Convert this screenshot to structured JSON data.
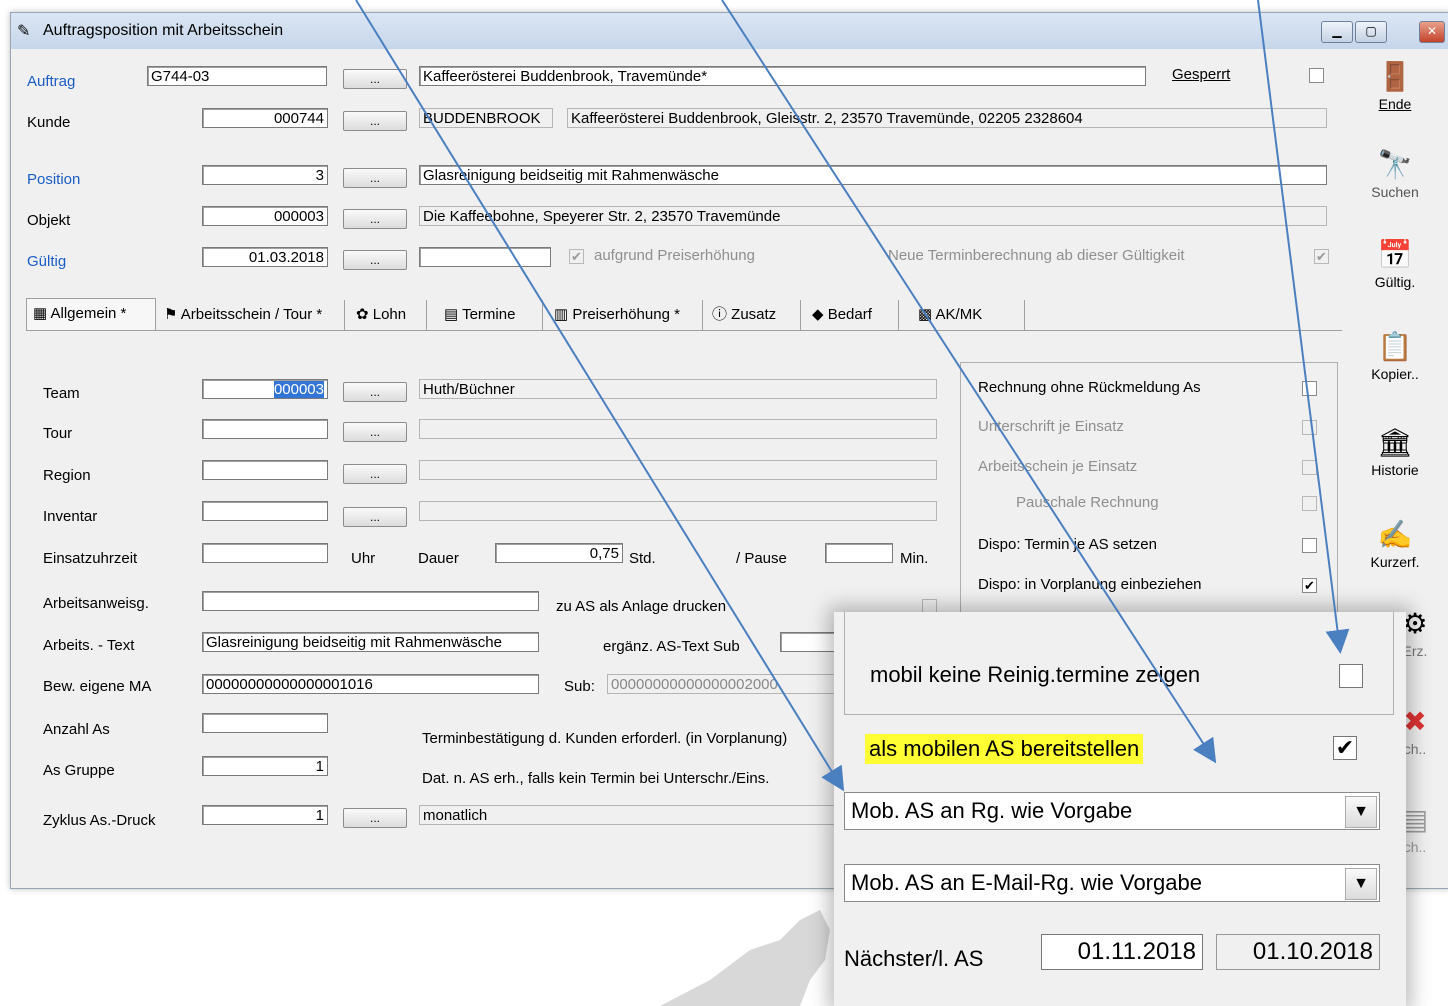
{
  "window": {
    "title": "Auftragsposition mit Arbeitsschein"
  },
  "header": {
    "auftrag_label": "Auftrag",
    "auftrag_value": "G744-03",
    "auftrag_desc": "Kaffeerösterei Buddenbrook, Travemünde*",
    "gesperrt_label": "Gesperrt",
    "kunde_label": "Kunde",
    "kunde_value": "000744",
    "kunde_short": "BUDDENBROOK",
    "kunde_desc": "Kaffeerösterei Buddenbrook, Gleisstr. 2, 23570 Travemünde, 02205 2328604",
    "position_label": "Position",
    "position_value": "3",
    "position_desc": "Glasreinigung beidseitig mit Rahmenwäsche",
    "objekt_label": "Objekt",
    "objekt_value": "000003",
    "objekt_desc": "Die Kaffeebohne, Speyerer Str. 2, 23570 Travemünde",
    "gueltig_label": "Gültig",
    "gueltig_value": "01.03.2018",
    "preis_label": "aufgrund Preiserhöhung",
    "termin_label": "Neue Terminberechnung ab dieser Gültigkeit",
    "dots": "..."
  },
  "tabs": [
    {
      "label": "Allgemein *"
    },
    {
      "label": "Arbeitsschein / Tour *"
    },
    {
      "label": "Lohn"
    },
    {
      "label": "Termine"
    },
    {
      "label": "Preiserhöhung *"
    },
    {
      "label": "Zusatz"
    },
    {
      "label": "Bedarf"
    },
    {
      "label": "AK/MK"
    }
  ],
  "form": {
    "team_label": "Team",
    "team_value": "000003",
    "team_desc": "Huth/Büchner",
    "tour_label": "Tour",
    "region_label": "Region",
    "inventar_label": "Inventar",
    "einsatz_label": "Einsatzuhrzeit",
    "uhr_label": "Uhr",
    "dauer_label": "Dauer",
    "dauer_value": "0,75",
    "std_label": "Std.",
    "pause_label": "/ Pause",
    "min_label": "Min.",
    "anweis_label": "Arbeitsanweisg.",
    "anlage_label": "zu AS als Anlage drucken",
    "text_label": "Arbeits. - Text",
    "text_value": "Glasreinigung beidseitig mit Rahmenwäsche",
    "ergaenz_label": "ergänz. AS-Text Sub",
    "bew_label": "Bew. eigene MA",
    "bew_value": "00000000000000001016",
    "sub_label": "Sub:",
    "sub_value": "00000000000000002000",
    "anzahl_label": "Anzahl As",
    "terminbest_label": "Terminbestätigung d. Kunden erforderl. (in Vorplanung)",
    "gruppe_label": "As Gruppe",
    "gruppe_value": "1",
    "dat_label": "Dat. n. AS erh., falls kein Termin bei Unterschr./Eins.",
    "zyklus_label": "Zyklus As.-Druck",
    "zyklus_value": "1",
    "zyklus_desc": "monatlich"
  },
  "right_group": [
    {
      "label": "Rechnung ohne Rückmeldung As",
      "checked": false,
      "enabled": true
    },
    {
      "label": "Unterschrift je Einsatz",
      "checked": false,
      "enabled": false
    },
    {
      "label": "Arbeitsschein je Einsatz",
      "checked": false,
      "enabled": false
    },
    {
      "label": "Pauschale Rechnung",
      "checked": false,
      "enabled": false
    },
    {
      "label": "Dispo: Termin je AS setzen",
      "checked": false,
      "enabled": true
    },
    {
      "label": "Dispo: in Vorplanung einbeziehen",
      "checked": true,
      "enabled": true
    },
    {
      "label": "mobil keine Reinig.termine zeigen",
      "checked": false,
      "enabled": true
    }
  ],
  "sidebar": [
    {
      "label": "Ende",
      "icon": "exit-door-icon",
      "glyph": "🚪"
    },
    {
      "label": "Suchen",
      "icon": "binoculars-icon",
      "glyph": "🔭"
    },
    {
      "label": "Gültig.",
      "icon": "calendar-icon",
      "glyph": "📅"
    },
    {
      "label": "Kopier..",
      "icon": "copy-icon",
      "glyph": "📋"
    },
    {
      "label": "Historie",
      "icon": "history-icon",
      "glyph": "🏛"
    },
    {
      "label": "Kurzerf.",
      "icon": "quick-entry-icon",
      "glyph": "✍"
    },
    {
      "label": "Erz.",
      "icon": "generate-icon",
      "glyph": "⚙"
    },
    {
      "label": "ch..",
      "icon": "delete-icon",
      "glyph": "✖"
    },
    {
      "label": "ch..",
      "icon": "print-icon",
      "glyph": "▤"
    }
  ],
  "zoom": {
    "mobil_label": "mobil keine Reinig.termine zeigen",
    "mobil_as_label": "als mobilen AS bereitstellen",
    "select1": "Mob. AS an Rg. wie Vorgabe",
    "select2": "Mob. AS an E-Mail-Rg. wie Vorgabe",
    "naechster_label": "Nächster/l. AS",
    "naechster_value": "01.11.2018",
    "letzter_value": "01.10.2018",
    "check_mark": "✔",
    "dropdown_arrow": "▼"
  },
  "colors": {
    "label_blue": "#1a5dc4",
    "highlight": "#ffff33",
    "arrow": "#4a7fc0"
  }
}
